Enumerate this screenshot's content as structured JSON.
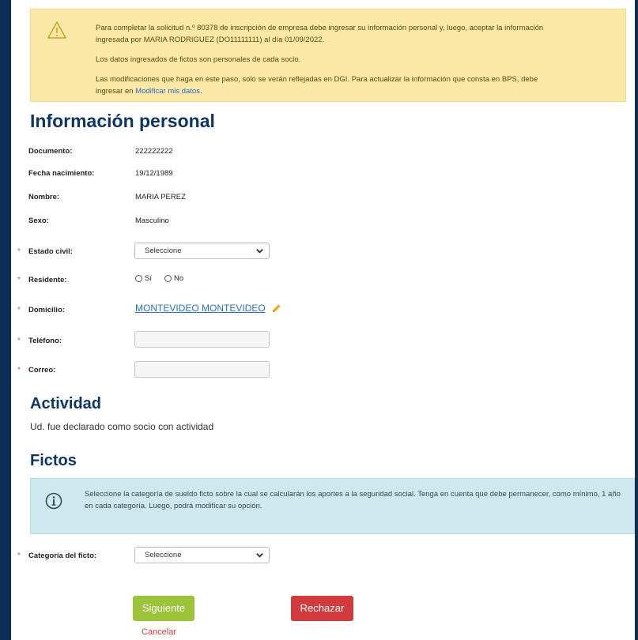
{
  "notice": {
    "line1": "Para completar la solicitud n.º 80378 de inscripción de empresa debe ingresar su información personal y, luego, aceptar la información",
    "line2": "ingresada por  MARIA RODRIGUEZ  (DO11111111) al día 01/09/2022.",
    "line3": "Los datos ingresados de fictos son personales de cada socio.",
    "line4": "Las modificaciones que haga en este paso, solo se verán reflejadas en DGI. Para actualizar la información que consta en BPS, debe",
    "line5_prefix": "ingresar en",
    "line5_link": "Modificar mis datos."
  },
  "section_personal": "Información personal",
  "fields": {
    "documento": {
      "label": "Documento:",
      "value": "222222222"
    },
    "fecha": {
      "label": "Fecha nacimiento:",
      "value": "19/12/1989"
    },
    "nombre": {
      "label": "Nombre:",
      "value": "MARIA PEREZ"
    },
    "sexo": {
      "label": "Sexo:",
      "value": "Masculino"
    },
    "estado_civil": {
      "label": "Estado civil:",
      "value": "Seleccione"
    },
    "residente": {
      "label": "Residente:",
      "opt_si": "Sí",
      "opt_no": "No"
    },
    "domicilio": {
      "label": "Domicilio:",
      "value": "MONTEVIDEO MONTEVIDEO"
    },
    "telefono": {
      "label": "Teléfono:",
      "value": ""
    },
    "correo": {
      "label": "Correo:",
      "value": ""
    }
  },
  "required_mark": "*",
  "section_actividad": "Actividad",
  "actividad_text": "Ud. fue declarado como socio con actividad",
  "section_fictos": "Fictos",
  "fictos_info": "Seleccione la categoría de sueldo ficto sobre la cual se calcularán los aportes a la seguridad social. Tenga en cuenta que debe permanecer, como mínimo, 1 año en cada categoría. Luego, podrá modificar su opción.",
  "categoria": {
    "label": "Categoría del ficto:",
    "value": "Seleccione"
  },
  "buttons": {
    "next": "Siguiente",
    "reject": "Rechazar",
    "cancel": "Cancelar"
  },
  "colors": {
    "heading": "#0d3566",
    "warning_bg": "#fbe8a6",
    "info_bg": "#cfe8ee",
    "next": "#9bc43a",
    "reject": "#d23b3e",
    "link": "#2a6fc6"
  }
}
